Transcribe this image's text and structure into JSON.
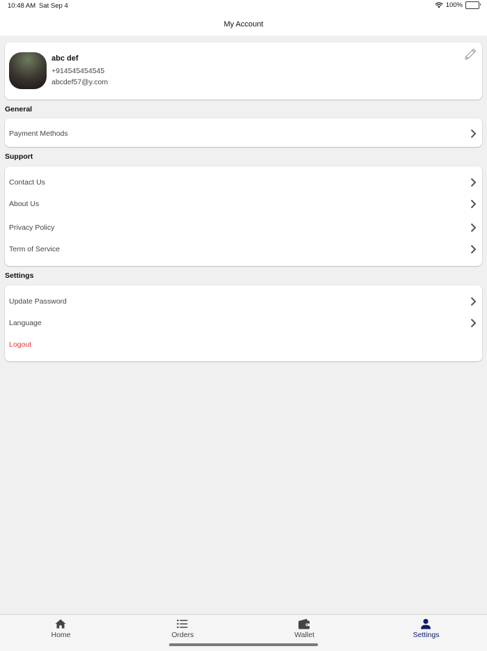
{
  "status_bar": {
    "time": "10:48 AM",
    "date": "Sat Sep 4",
    "battery": "100%"
  },
  "header": {
    "title": "My Account"
  },
  "profile": {
    "name": "abc def",
    "phone": "+914545454545",
    "email": "abcdef57@y.com",
    "edit_icon": "pencil-icon"
  },
  "sections": {
    "general": {
      "title": "General",
      "items": [
        {
          "label": "Payment Methods"
        }
      ]
    },
    "support": {
      "title": "Support",
      "items": [
        {
          "label": "Contact Us"
        },
        {
          "label": "About Us"
        },
        {
          "label": "Privacy Policy"
        },
        {
          "label": "Term of Service"
        }
      ]
    },
    "settings": {
      "title": "Settings",
      "items": [
        {
          "label": "Update Password"
        },
        {
          "label": "Language"
        },
        {
          "label": "Logout"
        }
      ]
    }
  },
  "tab_bar": {
    "tabs": [
      {
        "label": "Home",
        "icon": "home-icon"
      },
      {
        "label": "Orders",
        "icon": "list-icon"
      },
      {
        "label": "Wallet",
        "icon": "wallet-icon"
      },
      {
        "label": "Settings",
        "icon": "person-icon"
      }
    ],
    "active": "Settings"
  },
  "colors": {
    "accent": "#0c1a6e",
    "logout": "#e53935",
    "background": "#f0f0f0"
  }
}
